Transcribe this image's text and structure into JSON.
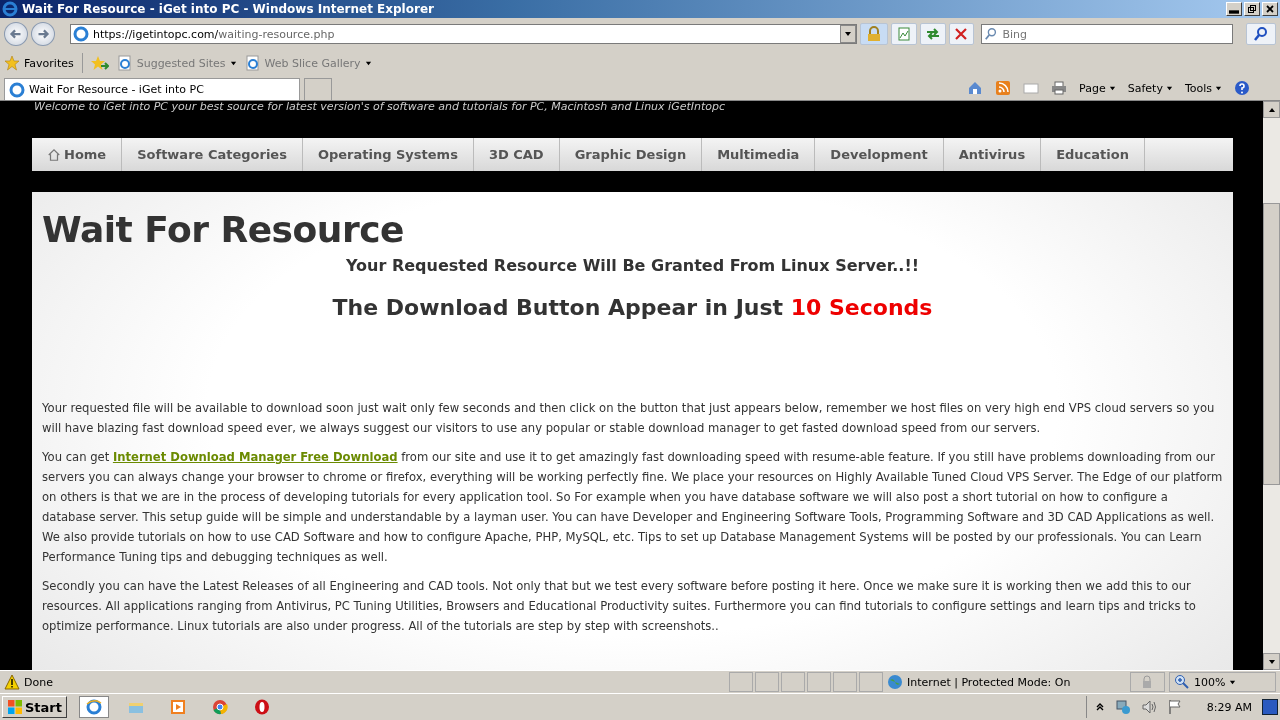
{
  "window": {
    "title": "Wait For Resource - iGet into PC - Windows Internet Explorer"
  },
  "address_bar": {
    "url_host": "https://igetintopc.com/",
    "url_path": "waiting-resource.php"
  },
  "search": {
    "placeholder": "Bing"
  },
  "favorites_bar": {
    "favorites": "Favorites",
    "links": [
      "Suggested Sites",
      "Web Slice Gallery"
    ]
  },
  "tabs": [
    {
      "label": "Wait For Resource - iGet into PC",
      "selected": true
    }
  ],
  "command_bar": [
    "Page",
    "Safety",
    "Tools"
  ],
  "page": {
    "tagline": "Welcome to iGet into PC your best source for latest version's of software and tutorials for PC, Macintosh and Linux iGetIntopc",
    "nav": [
      {
        "label": "Home",
        "kind": "home"
      },
      {
        "label": "Software Categories",
        "kind": "link"
      },
      {
        "label": "Operating Systems",
        "kind": "link"
      },
      {
        "label": "3D CAD",
        "kind": "link"
      },
      {
        "label": "Graphic Design",
        "kind": "link"
      },
      {
        "label": "Multimedia",
        "kind": "link"
      },
      {
        "label": "Development",
        "kind": "link"
      },
      {
        "label": "Antivirus",
        "kind": "link"
      },
      {
        "label": "Education",
        "kind": "link"
      }
    ],
    "heading": "Wait For Resource",
    "subheading": "Your Requested Resource Will Be Granted From Linux Server..!!",
    "countdown": {
      "text": "The Download Button Appear in Just ",
      "highlight": "10 Seconds"
    },
    "paragraphs": [
      {
        "before": "Your requested file will be available to download soon just wait only few seconds and then click on the button that just appears below, remember we host files on very high end VPS cloud servers so you will have blazing fast download speed ever, we always suggest our visitors to use any popular or stable download manager to get fasted download speed from our servers."
      },
      {
        "before": "You can get ",
        "link": "Internet Download Manager Free Download",
        "after": " from our site and use it to get amazingly fast downloading speed with resume-able feature. If you still have problems downloading from our servers you can always change your browser to chrome or firefox, everything will be working perfectly fine. We place your resources on Highly Available Tuned Cloud VPS Server. The Edge of our platform on others is that we are in the process of developing tutorials for every application tool. So For example when you have database software we will also post a short tutorial on how to configure a database server. This setup guide will be simple and understandable by a layman user. You can have Developer and Engineering Software Tools, Programming Software and 3D CAD Applications as well. We also provide tutorials on how to use CAD Software and how to configure Apache, PHP, MySQL, etc. Tips to set up Database Management Systems will be posted by our professionals. You can Learn Performance Tuning tips and debugging techniques as well."
      },
      {
        "before": "Secondly you can have the Latest Releases of all Engineering and CAD tools. Not only that but we test every software before posting it here. Once we make sure it is working then we add this to our resources. All applications ranging from Antivirus, PC Tuning Utilities, Browsers and Educational Productivity suites. Furthermore you can find tutorials to configure settings and learn tips and tricks to optimize performance. Linux tutorials are also under progress. All of the tutorials are step by step with screenshots.."
      }
    ]
  },
  "status_bar": {
    "status": "Done",
    "zone": "Internet | Protected Mode: On",
    "zoom": "100%"
  },
  "taskbar": {
    "start": "Start",
    "clock": "8:29 AM"
  }
}
